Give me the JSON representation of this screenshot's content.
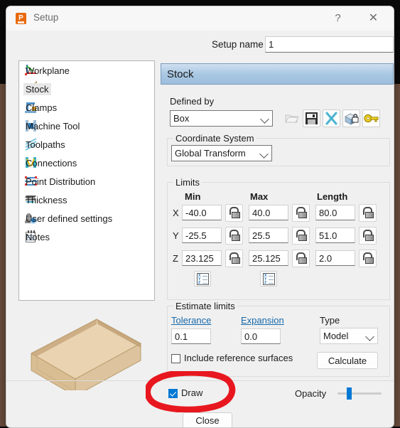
{
  "window": {
    "title": "Setup",
    "app_icon": "powermill-p-icon",
    "help_label": "?",
    "close_label": "✕"
  },
  "setup_name": {
    "label": "Setup name",
    "value": "1",
    "placeholder": ""
  },
  "tree": {
    "items": [
      {
        "label": "Workplane",
        "icon": "workplane-icon",
        "selected": false
      },
      {
        "label": "Stock",
        "icon": "stock-box-icon",
        "selected": true
      },
      {
        "label": "Clamps",
        "icon": "clamps-icon",
        "selected": false
      },
      {
        "label": "Machine Tool",
        "icon": "machine-tool-icon",
        "selected": false
      },
      {
        "label": "Toolpaths",
        "icon": "toolpaths-icon",
        "selected": false
      },
      {
        "label": "Connections",
        "icon": "connections-icon",
        "selected": false
      },
      {
        "label": "Point Distribution",
        "icon": "point-distribution-icon",
        "selected": false
      },
      {
        "label": "Thickness",
        "icon": "thickness-icon",
        "selected": false
      },
      {
        "label": "User defined settings",
        "icon": "user-settings-icon",
        "selected": false
      },
      {
        "label": "Notes",
        "icon": "notes-icon",
        "selected": false
      }
    ]
  },
  "preview": {
    "name": "stock-box-3d-preview"
  },
  "panel": {
    "header": "Stock",
    "defined_by": {
      "label": "Defined by",
      "value": "Box",
      "toolbar": [
        {
          "name": "open-folder-icon",
          "enabled": false
        },
        {
          "name": "save-icon",
          "enabled": true
        },
        {
          "name": "delete-x-icon",
          "enabled": true
        },
        {
          "name": "lock-box-icon",
          "enabled": true
        },
        {
          "name": "key-icon",
          "enabled": true
        }
      ]
    },
    "coordinate_system": {
      "label": "Coordinate System",
      "value": "Global Transform"
    },
    "limits": {
      "title": "Limits",
      "columns": [
        "Min",
        "Max",
        "Length"
      ],
      "rows": [
        {
          "axis": "X",
          "min": "-40.0",
          "max": "40.0",
          "length": "80.0"
        },
        {
          "axis": "Y",
          "min": "-25.5",
          "max": "25.5",
          "length": "51.0"
        },
        {
          "axis": "Z",
          "min": "23.125",
          "max": "25.125",
          "length": "2.0"
        }
      ],
      "lock_icon": "padlock-open-icon",
      "xyz_button_icon": "xyz-list-icon"
    },
    "estimate_limits": {
      "title": "Estimate limits",
      "tolerance_label": "Tolerance",
      "tolerance_value": "0.1",
      "expansion_label": "Expansion",
      "expansion_value": "0.0",
      "type_label": "Type",
      "type_value": "Model",
      "include_ref_label": "Include reference surfaces",
      "include_ref_checked": false,
      "calculate_label": "Calculate"
    }
  },
  "footer": {
    "draw_label": "Draw",
    "draw_checked": true,
    "opacity_label": "Opacity",
    "opacity_percent": 25,
    "close_label": "Close"
  },
  "annotation": {
    "shape": "red-ellipse-highlight",
    "color": "#e8171f",
    "target": "draw-checkbox"
  },
  "colors": {
    "accent": "#0078d4",
    "header_gradient_top": "#cfe0f0",
    "header_gradient_bottom": "#9dbedd",
    "link": "#1769aa",
    "annotation_red": "#e8171f",
    "stock_tan": "#e0c49a"
  }
}
